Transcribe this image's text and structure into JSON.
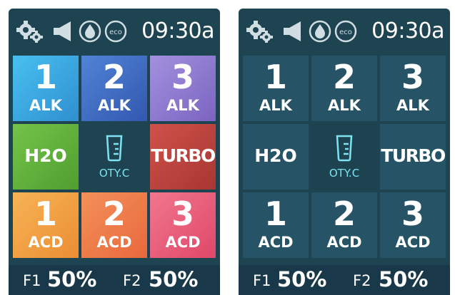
{
  "status": {
    "time": "09:30a",
    "icons": [
      "settings-gear-icon",
      "speaker-icon",
      "water-drop-icon",
      "eco-icon"
    ]
  },
  "tiles": {
    "alk1": {
      "num": "1",
      "label": "ALK"
    },
    "alk2": {
      "num": "2",
      "label": "ALK"
    },
    "alk3": {
      "num": "3",
      "label": "ALK"
    },
    "h2o": {
      "label": "H2O"
    },
    "qty": {
      "label": "OTY.C",
      "icon": "measuring-cup-icon"
    },
    "turbo": {
      "label": "TURBO"
    },
    "acd1": {
      "num": "1",
      "label": "ACD"
    },
    "acd2": {
      "num": "2",
      "label": "ACD"
    },
    "acd3": {
      "num": "3",
      "label": "ACD"
    }
  },
  "footer": {
    "f1_label": "F1",
    "f1_value": "50%",
    "f2_label": "F2",
    "f2_value": "50%"
  },
  "colors": {
    "panel_bg": "#1e4452",
    "alk1": "#3aa6e0",
    "alk2": "#3f6fc6",
    "alk3": "#8f7ad0",
    "h2o": "#62b63e",
    "turbo": "#c0463f",
    "acd1": "#f2a040",
    "acd2": "#f07a47",
    "acd3": "#e85a7c",
    "qty_text": "#7ee2f0"
  }
}
